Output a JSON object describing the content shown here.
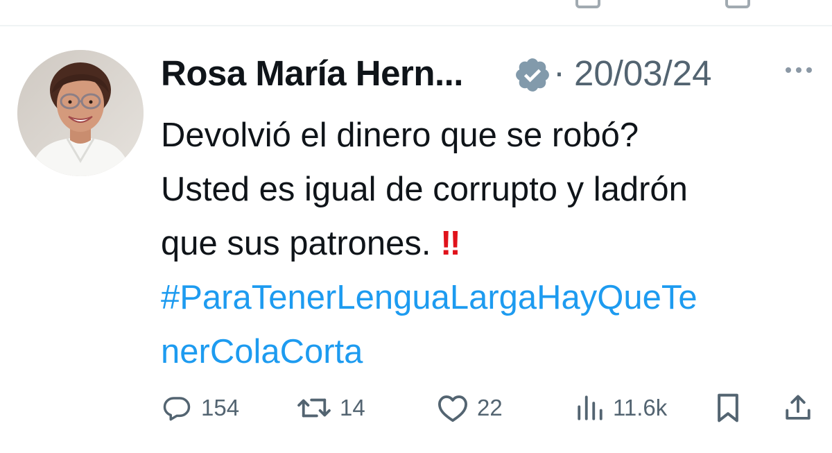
{
  "tweet": {
    "author_name": "Rosa María Hern...",
    "separator": "·",
    "date": "20/03/24",
    "text_lines": [
      "Devolvió el dinero que se robó?",
      "Usted es igual de corrupto y ladrón",
      "que sus patrones. "
    ],
    "emoji": "‼",
    "hashtag_lines": [
      "#ParaTenerLenguaLargaHayQueTe",
      "nerColaCorta"
    ]
  },
  "actions": {
    "replies": "154",
    "retweets": "14",
    "likes": "22",
    "views": "11.6k"
  },
  "colors": {
    "text": "#0f1419",
    "secondary": "#536471",
    "link": "#1d9bf0",
    "verified": "#829aab",
    "emoji": "#e0121b"
  },
  "icons": [
    "verified-badge-icon",
    "more-icon",
    "reply-icon",
    "retweet-icon",
    "like-icon",
    "views-icon",
    "bookmark-icon",
    "share-icon"
  ]
}
